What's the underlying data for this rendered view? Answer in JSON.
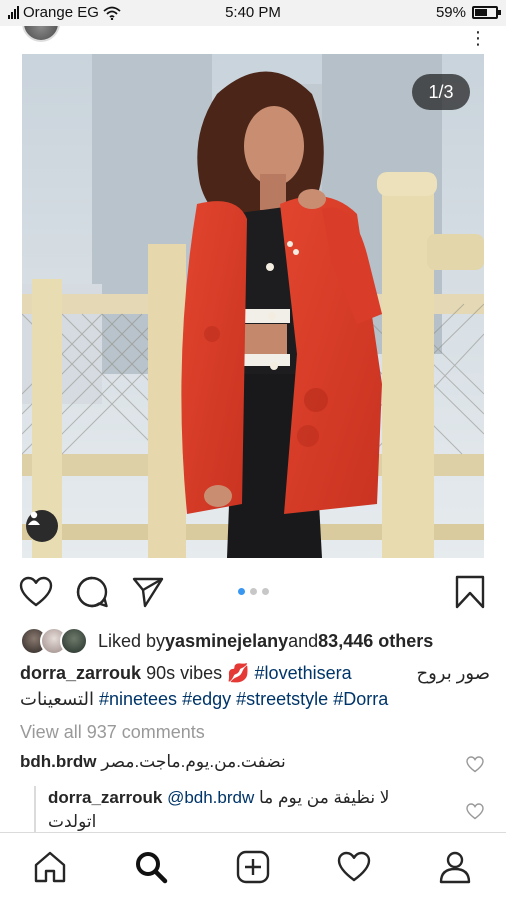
{
  "status_bar": {
    "carrier": "Orange EG",
    "time": "5:40 PM",
    "battery_percent": "59%",
    "battery_level": 0.59
  },
  "post": {
    "image_counter": "1/3",
    "carousel_index": 1,
    "carousel_total": 3,
    "likes": {
      "prefix": "Liked by ",
      "user": "yasminejelany",
      "connector": " and ",
      "count": "83,446 others"
    },
    "caption": {
      "user": "dorra_zarrouk",
      "text": "90s vibes 💋",
      "tag1": "#lovethisera",
      "arabic_line1": "صور بروح",
      "arabic_line2": "التسعينات",
      "tag2": "#ninetees",
      "tag3": "#edgy",
      "tag4": "#streetstyle",
      "tag5": "#Dorra"
    },
    "view_all_comments": "View all 937 comments",
    "comments": [
      {
        "user": "bdh.brdw",
        "text": "نضفت.من.يوم.ماجت.مصر"
      },
      {
        "user": "dorra_zarrouk",
        "mention": "@bdh.brdw",
        "text_line1": "لا نظيفة من يوم ما",
        "text_line2": "اتولدت"
      }
    ]
  },
  "icons": {
    "like": "heart-icon",
    "comment": "comment-icon",
    "share": "share-icon",
    "save": "bookmark-icon",
    "nav": [
      "home-icon",
      "search-icon",
      "add-post-icon",
      "activity-icon",
      "profile-icon"
    ]
  },
  "colors": {
    "link": "#003569",
    "active_dot": "#3897f0",
    "muted": "#999999"
  }
}
